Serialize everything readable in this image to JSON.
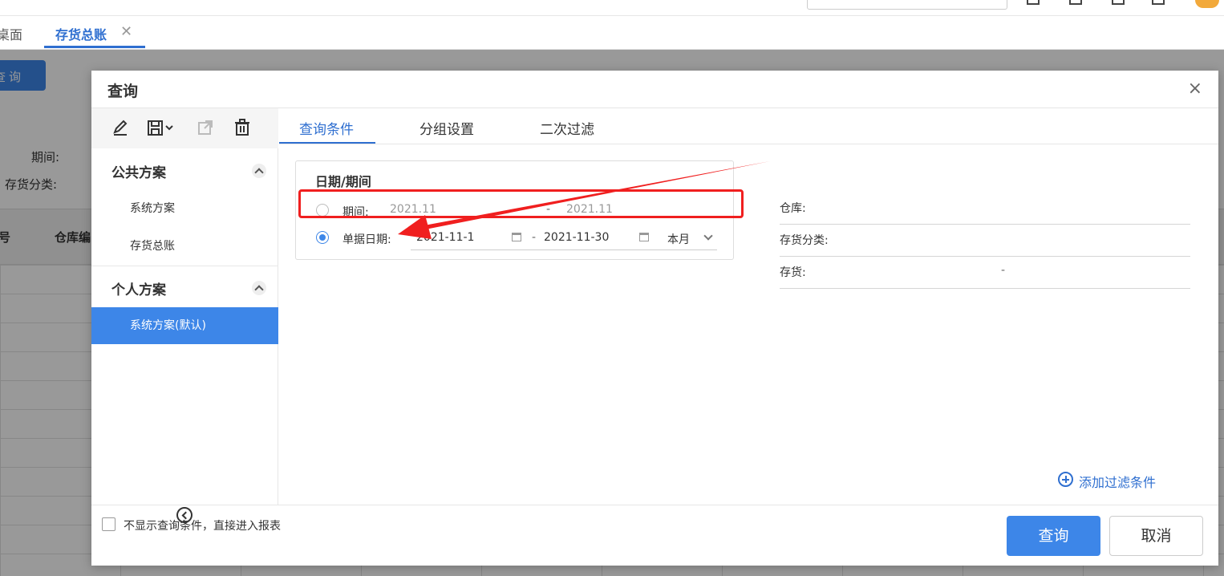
{
  "tabs": [
    {
      "label": "桌面"
    },
    {
      "label": "存货总账"
    }
  ],
  "background": {
    "query_button": "查询",
    "period_label": "期间:",
    "category_label": "存货分类:",
    "table_headers": [
      "号",
      "仓库编"
    ]
  },
  "dialog": {
    "title": "查询",
    "close_symbol": "×",
    "public_section": "公共方案",
    "public_items": [
      {
        "label": "系统方案"
      },
      {
        "label": "存货总账"
      }
    ],
    "personal_section": "个人方案",
    "personal_items": [
      {
        "label": "系统方案(默认)"
      }
    ],
    "tabs": [
      {
        "label": "查询条件"
      },
      {
        "label": "分组设置"
      },
      {
        "label": "二次过滤"
      }
    ],
    "date_section": {
      "title": "日期/期间",
      "period_label": "期间:",
      "period_from": "2021.11",
      "period_to": "2021.11",
      "doc_date_label": "单据日期:",
      "date_from": "2021-11-1",
      "date_to": "2021-11-30",
      "range_preset": "本月",
      "separator": "-"
    },
    "filters": [
      {
        "label": "仓库:"
      },
      {
        "label": "存货分类:"
      },
      {
        "label": "存货:"
      }
    ],
    "add_filter": "添加过滤条件",
    "skip_checkbox_label": "不显示查询条件，直接进入报表",
    "query_button": "查询",
    "cancel_button": "取消"
  },
  "colors": {
    "primary": "#3d86e8",
    "highlight": "#f01f1f"
  }
}
